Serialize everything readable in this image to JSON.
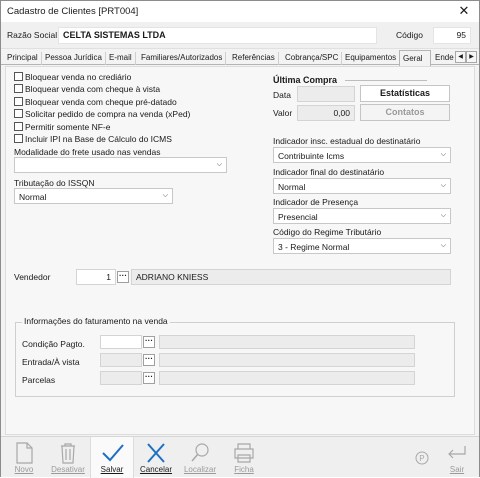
{
  "window": {
    "title": "Cadastro de Clientes [PRT004]"
  },
  "header": {
    "razao_label": "Razão Social",
    "razao_value": "CELTA SISTEMAS LTDA",
    "codigo_label": "Código",
    "codigo_value": "95"
  },
  "tabs": [
    {
      "label": "Principal"
    },
    {
      "label": "Pessoa Jurídica"
    },
    {
      "label": "E-mail"
    },
    {
      "label": "Familiares/Autorizados"
    },
    {
      "label": "Referências"
    },
    {
      "label": "Cobrança/SPC"
    },
    {
      "label": "Equipamentos"
    },
    {
      "label": "Geral",
      "active": true
    },
    {
      "label": "Ende"
    }
  ],
  "checkboxes": [
    {
      "label": "Bloquear venda no crediário",
      "checked": false
    },
    {
      "label": "Bloquear venda com cheque à vista",
      "checked": false
    },
    {
      "label": "Bloquear venda com cheque pré-datado",
      "checked": false
    },
    {
      "label": "Solicitar pedido de compra na venda (xPed)",
      "checked": false
    },
    {
      "label": "Permitir somente NF-e",
      "checked": false
    },
    {
      "label": "Incluir IPI na Base de Cálculo do ICMS",
      "checked": false
    }
  ],
  "frete": {
    "label": "Modalidade do frete usado nas vendas",
    "value": ""
  },
  "issqn": {
    "label": "Tributação do ISSQN",
    "value": "Normal"
  },
  "ultima_compra": {
    "title": "Última Compra",
    "data_label": "Data",
    "data_value": "",
    "valor_label": "Valor",
    "valor_value": "0,00",
    "estatisticas_label": "Estatísticas",
    "contatos_label": "Contatos"
  },
  "indicador_ie": {
    "label": "Indicador insc. estadual do destinatário",
    "value": "Contribuinte Icms"
  },
  "indicador_final": {
    "label": "Indicador final do destinatário",
    "value": "Normal"
  },
  "indicador_presenca": {
    "label": "Indicador de Presença",
    "value": "Presencial"
  },
  "regime": {
    "label": "Código do Regime Tributário",
    "value": "3 - Regime Normal"
  },
  "vendedor": {
    "label": "Vendedor",
    "code": "1",
    "name": "ADRIANO KNIESS"
  },
  "faturamento": {
    "title": "Informações do faturamento na venda",
    "condicao_label": "Condição Pagto.",
    "entrada_label": "Entrada/À vista",
    "parcelas_label": "Parcelas",
    "dots": "···"
  },
  "toolbar": {
    "novo": "Novo",
    "desativar": "Desativar",
    "salvar": "Salvar",
    "cancelar": "Cancelar",
    "localizar": "Localizar",
    "ficha": "Ficha",
    "sair": "Sair"
  },
  "colors": {
    "accent": "#1e6fc4",
    "disabled": "#9a9a9a"
  }
}
